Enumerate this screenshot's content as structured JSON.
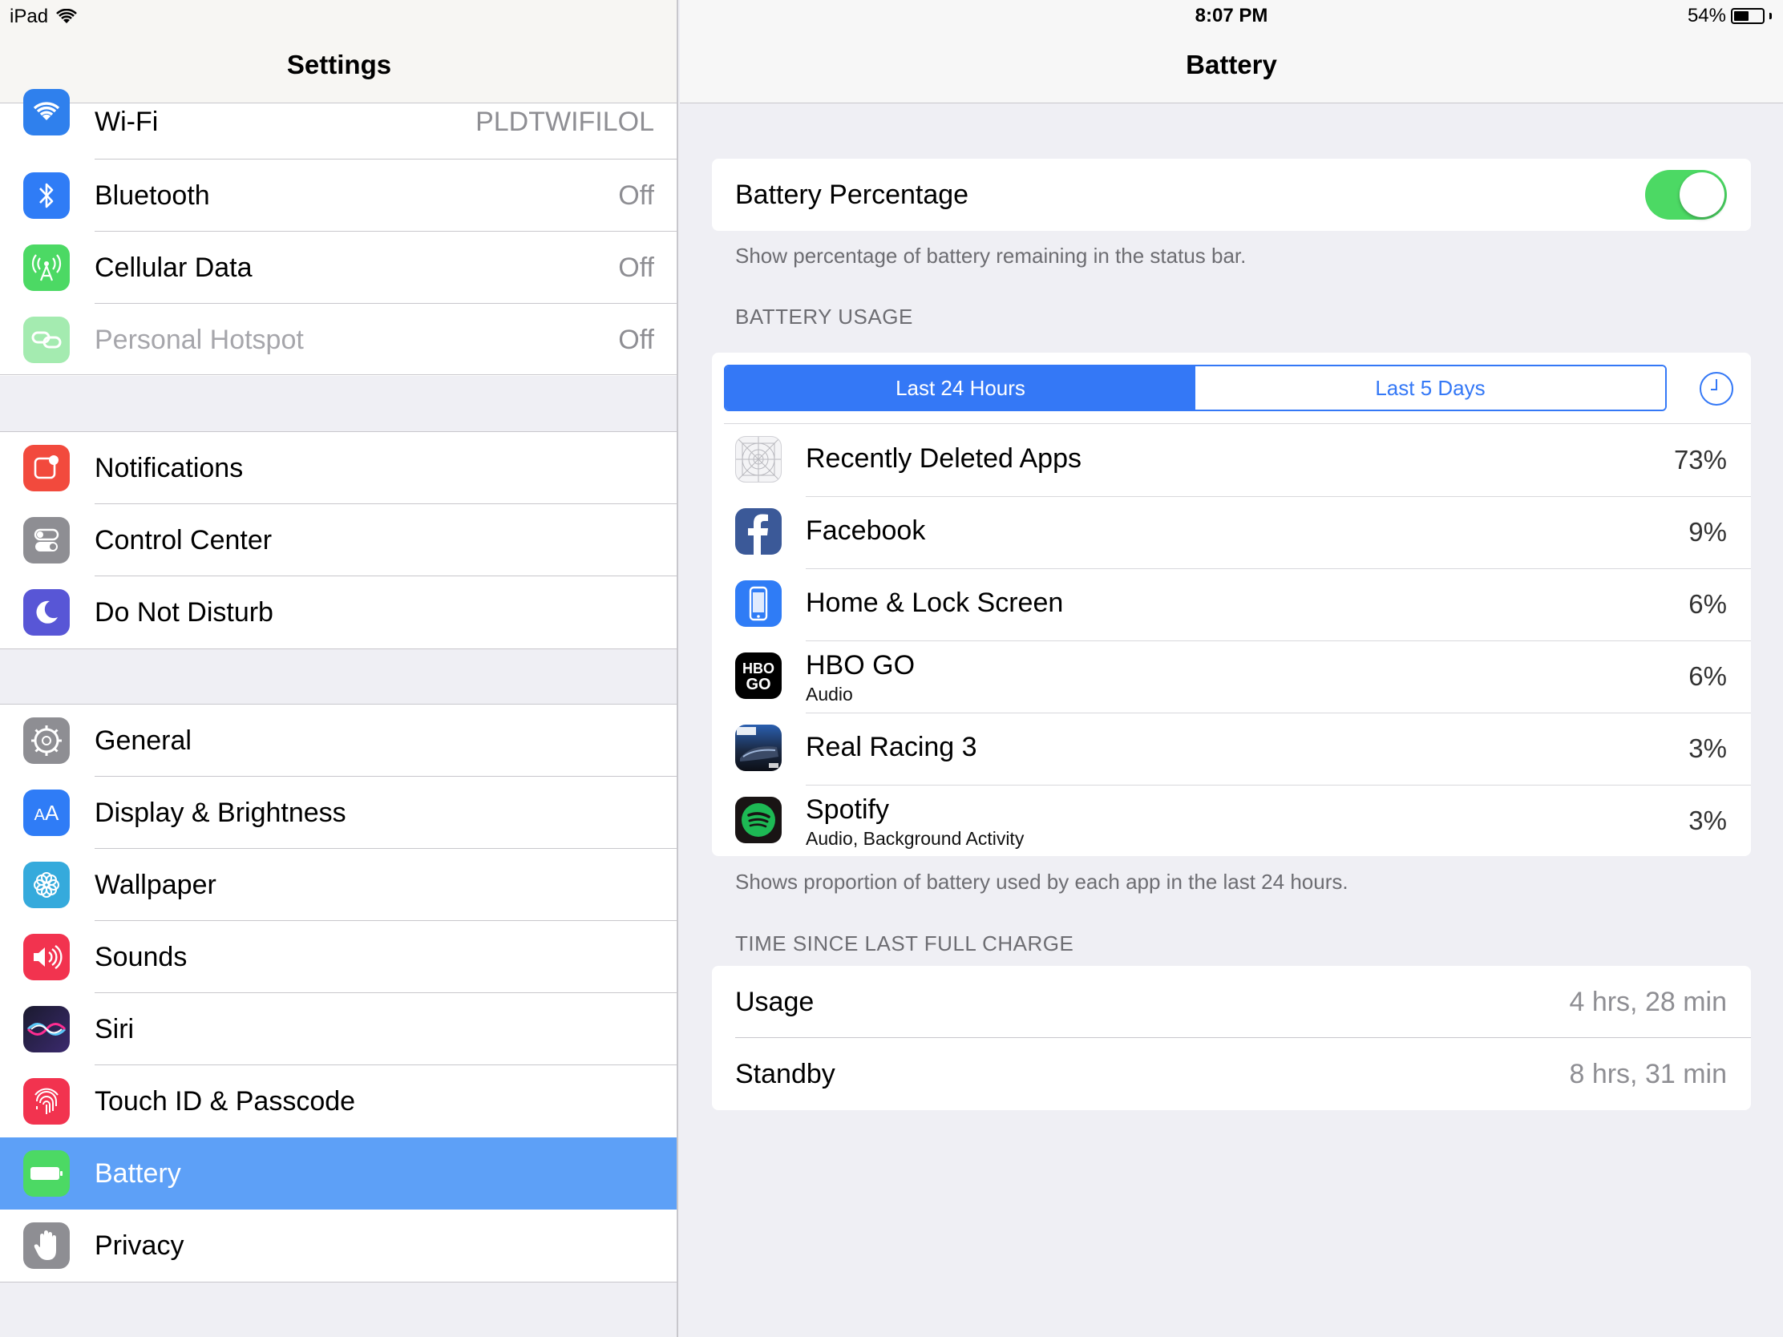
{
  "status_bar": {
    "device": "iPad",
    "time": "8:07 PM",
    "battery_percent_text": "54%",
    "battery_level": 0.54
  },
  "sidebar": {
    "title": "Settings",
    "group1": [
      {
        "label": "Wi-Fi",
        "value": "PLDTWIFILOL",
        "icon": "wifi-icon",
        "color": "#2f80ed"
      },
      {
        "label": "Bluetooth",
        "value": "Off",
        "icon": "bluetooth-icon",
        "color": "#2f7cf6"
      },
      {
        "label": "Cellular Data",
        "value": "Off",
        "icon": "cellular-icon",
        "color": "#4cd964"
      },
      {
        "label": "Personal Hotspot",
        "value": "Off",
        "icon": "hotspot-icon",
        "color": "#4cd964"
      }
    ],
    "group2": [
      {
        "label": "Notifications",
        "icon": "notifications-icon",
        "color": "#f24a3d"
      },
      {
        "label": "Control Center",
        "icon": "control-center-icon",
        "color": "#8e8e93"
      },
      {
        "label": "Do Not Disturb",
        "icon": "moon-icon",
        "color": "#5856d6"
      }
    ],
    "group3": [
      {
        "label": "General",
        "icon": "gear-icon",
        "color": "#8e8e93"
      },
      {
        "label": "Display & Brightness",
        "icon": "display-icon",
        "color": "#2f7cf6"
      },
      {
        "label": "Wallpaper",
        "icon": "wallpaper-icon",
        "color": "#35aadc"
      },
      {
        "label": "Sounds",
        "icon": "speaker-icon",
        "color": "#f2334f"
      },
      {
        "label": "Siri",
        "icon": "siri-icon",
        "color": "#222"
      },
      {
        "label": "Touch ID & Passcode",
        "icon": "fingerprint-icon",
        "color": "#f2334f"
      },
      {
        "label": "Battery",
        "icon": "battery-icon",
        "color": "#4cd964",
        "selected": true
      },
      {
        "label": "Privacy",
        "icon": "hand-icon",
        "color": "#8e8e93"
      }
    ]
  },
  "battery": {
    "title": "Battery",
    "percentage_label": "Battery Percentage",
    "percentage_on": true,
    "percentage_footer": "Show percentage of battery remaining in the status bar.",
    "usage_header": "BATTERY USAGE",
    "tabs": [
      "Last 24 Hours",
      "Last 5 Days"
    ],
    "apps": [
      {
        "name": "Recently Deleted Apps",
        "sub": "",
        "pct": "73%",
        "icon": "deleted-apps-icon"
      },
      {
        "name": "Facebook",
        "sub": "",
        "pct": "9%",
        "icon": "facebook-icon"
      },
      {
        "name": "Home & Lock Screen",
        "sub": "",
        "pct": "6%",
        "icon": "home-lock-icon"
      },
      {
        "name": "HBO GO",
        "sub": "Audio",
        "pct": "6%",
        "icon": "hbo-go-icon"
      },
      {
        "name": "Real Racing 3",
        "sub": "",
        "pct": "3%",
        "icon": "real-racing-icon"
      },
      {
        "name": "Spotify",
        "sub": "Audio, Background Activity",
        "pct": "3%",
        "icon": "spotify-icon"
      }
    ],
    "usage_footer": "Shows proportion of battery used by each app in the last 24 hours.",
    "charge_header": "TIME SINCE LAST FULL CHARGE",
    "usage_label": "Usage",
    "usage_value": "4 hrs, 28 min",
    "standby_label": "Standby",
    "standby_value": "8 hrs, 31 min"
  }
}
